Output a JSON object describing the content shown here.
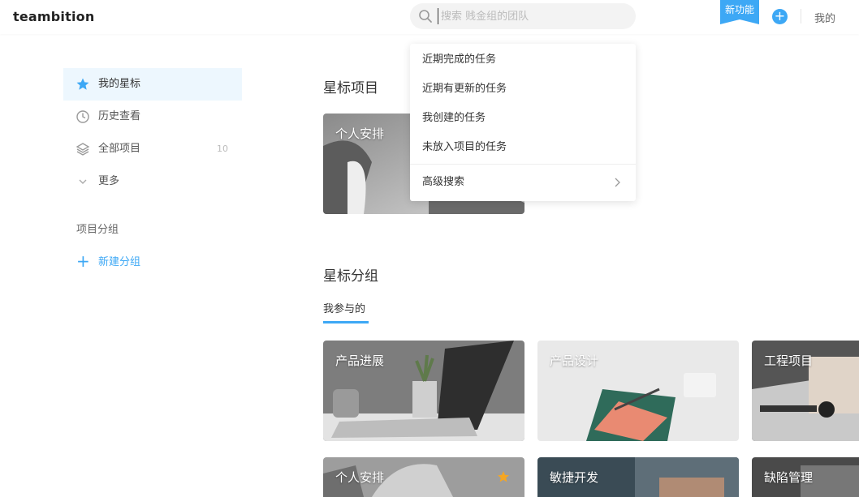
{
  "header": {
    "logo": "teambition",
    "search_placeholder": "搜索 贱金组的团队",
    "new_feature_label": "新功能",
    "plus_label": "+",
    "mine_label": "我的"
  },
  "sidebar": {
    "items": [
      {
        "label": "我的星标",
        "icon": "star-icon",
        "active": true
      },
      {
        "label": "历史查看",
        "icon": "clock-icon"
      },
      {
        "label": "全部项目",
        "icon": "layers-icon",
        "count": "10"
      },
      {
        "label": "更多",
        "icon": "chevron-down-icon"
      }
    ],
    "group_section_label": "项目分组",
    "new_group_label": "新建分组"
  },
  "main": {
    "starred_projects_title": "星标项目",
    "starred_groups_title": "星标分组",
    "tab_label": "我参与的",
    "starred_projects": [
      {
        "title": "个人安排"
      }
    ],
    "group_cards": [
      {
        "title": "产品进展"
      },
      {
        "title": "产品设计"
      },
      {
        "title": "工程项目"
      },
      {
        "title": "个人安排",
        "starred": true
      },
      {
        "title": "敏捷开发"
      },
      {
        "title": "缺陷管理"
      }
    ]
  },
  "search_dropdown": {
    "items": [
      "近期完成的任务",
      "近期有更新的任务",
      "我创建的任务",
      "未放入项目的任务"
    ],
    "advanced_label": "高级搜索"
  },
  "colors": {
    "accent": "#3da8f5",
    "active_bg": "#edf7fe",
    "star": "#f5a623"
  }
}
